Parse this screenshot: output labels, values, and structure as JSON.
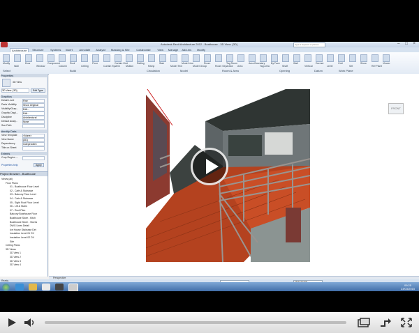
{
  "window": {
    "title": "Autodesk Revit Architecture 2012 - Boathouse - 3D View: {3D}",
    "search_placeholder": "Type a keyword or phrase",
    "controls": [
      "–",
      "□",
      "×"
    ]
  },
  "ribbon": {
    "tabs": [
      "Architecture",
      "Structure",
      "Systems",
      "Insert",
      "Annotate",
      "Analyze",
      "Massing & Site",
      "Collaborate",
      "View",
      "Manage",
      "Add-Ins",
      "Modify"
    ],
    "active_tab": "Architecture",
    "buttons": [
      "Modify",
      "Wall",
      "Door",
      "Window",
      "Component",
      "Column",
      "Roof",
      "Ceiling",
      "Floor",
      "Curtain System",
      "Curtain Grid",
      "Mullion",
      "Railing",
      "Ramp",
      "Stair",
      "Model Text",
      "Model Line",
      "Model Group",
      "Room",
      "Room Separator",
      "Tag Room",
      "Area",
      "Area Boundary",
      "Tag Area",
      "By Face",
      "Shaft",
      "Wall",
      "Vertical",
      "Dormer",
      "Level",
      "Grid",
      "Set",
      "Show",
      "Ref Plane",
      "Viewer"
    ],
    "groups": [
      "Select",
      "Build",
      "Circulation",
      "Model",
      "Room & Area",
      "Opening",
      "Datum",
      "Work Plane"
    ]
  },
  "properties": {
    "header": "Properties",
    "type_name": "3D View",
    "type_selector": "3D View: {3D}",
    "edit_type": "Edit Type",
    "sections": [
      {
        "title": "Graphics",
        "rows": [
          {
            "label": "Detail Level",
            "value": "Fine"
          },
          {
            "label": "Parts Visibility",
            "value": "Show Original"
          },
          {
            "label": "Visibility/Grap...",
            "value": "Edit..."
          },
          {
            "label": "Graphic Displ...",
            "value": "Edit..."
          },
          {
            "label": "Discipline",
            "value": "Architectural"
          },
          {
            "label": "Default Analy...",
            "value": "None"
          },
          {
            "label": "Sun Path",
            "value": ""
          }
        ]
      },
      {
        "title": "Identity Data",
        "rows": [
          {
            "label": "View Template",
            "value": "<None>"
          },
          {
            "label": "View Name",
            "value": "{3D}"
          },
          {
            "label": "Dependency",
            "value": "Independent"
          },
          {
            "label": "Title on Sheet",
            "value": ""
          }
        ]
      },
      {
        "title": "Extents",
        "rows": [
          {
            "label": "Crop Region ...",
            "value": ""
          }
        ]
      }
    ],
    "help_link": "Properties help",
    "apply": "Apply"
  },
  "browser": {
    "title": "Project Browser - Boathouse",
    "items": [
      {
        "text": "Views (all)",
        "indent": 0
      },
      {
        "text": "Floor Plans",
        "indent": 1
      },
      {
        "text": "01 - Boathouse Floor Level",
        "indent": 2
      },
      {
        "text": "02 - Cafe & Staircase",
        "indent": 2
      },
      {
        "text": "03 - Balcony Floor Level",
        "indent": 2
      },
      {
        "text": "04 - Cafe & Staircase",
        "indent": 2
      },
      {
        "text": "05 - Sight Roof Floor Level",
        "indent": 2
      },
      {
        "text": "06 - Lift & Stairs",
        "indent": 2
      },
      {
        "text": "07 - Roof Plan",
        "indent": 2
      },
      {
        "text": "Balcony Boathouse Floor",
        "indent": 2
      },
      {
        "text": "Boathouse Store - Kitch",
        "indent": 2
      },
      {
        "text": "Boathouse Store - Stores",
        "indent": 2
      },
      {
        "text": "DWG Lines Detail",
        "indent": 2
      },
      {
        "text": "Ice House Staircase Det",
        "indent": 2
      },
      {
        "text": "Insulation Level 01 DV",
        "indent": 2
      },
      {
        "text": "Insulation Level 02 DV",
        "indent": 2
      },
      {
        "text": "Site",
        "indent": 2
      },
      {
        "text": "Ceiling Plans",
        "indent": 1
      },
      {
        "text": "3D Views",
        "indent": 1
      },
      {
        "text": "3D View 1",
        "indent": 2
      },
      {
        "text": "3D View 2",
        "indent": 2
      },
      {
        "text": "3D View 3",
        "indent": 2
      },
      {
        "text": "3D View 4",
        "indent": 2
      }
    ]
  },
  "viewport": {
    "viewcube": "FRONT",
    "view_bar": "Perspective"
  },
  "status": {
    "text": "Ready",
    "main_model": "Main Model"
  },
  "taskbar": {
    "time": "09:25",
    "date": "23/03/2015"
  },
  "video": {
    "progress_percent": 0,
    "play_label": "Play",
    "volume_label": "Volume",
    "pip_label": "Pop out",
    "share_label": "Share",
    "fullscreen_label": "Full screen"
  },
  "colors": {
    "accent": "#3d6aa5",
    "deck": "#b4421f",
    "progress": "#d33333"
  }
}
